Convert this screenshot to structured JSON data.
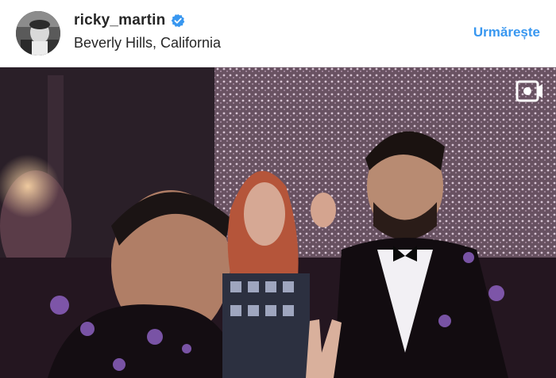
{
  "post": {
    "username": "ricky_martin",
    "verified": true,
    "location": "Beverly Hills, California",
    "follow_label": "Urmărește",
    "media_type": "video"
  },
  "icons": {
    "verified": "verified-badge-icon",
    "video": "video-camera-icon"
  },
  "colors": {
    "link_blue": "#3897f0",
    "verified_blue": "#3897f0",
    "text": "#262626"
  }
}
